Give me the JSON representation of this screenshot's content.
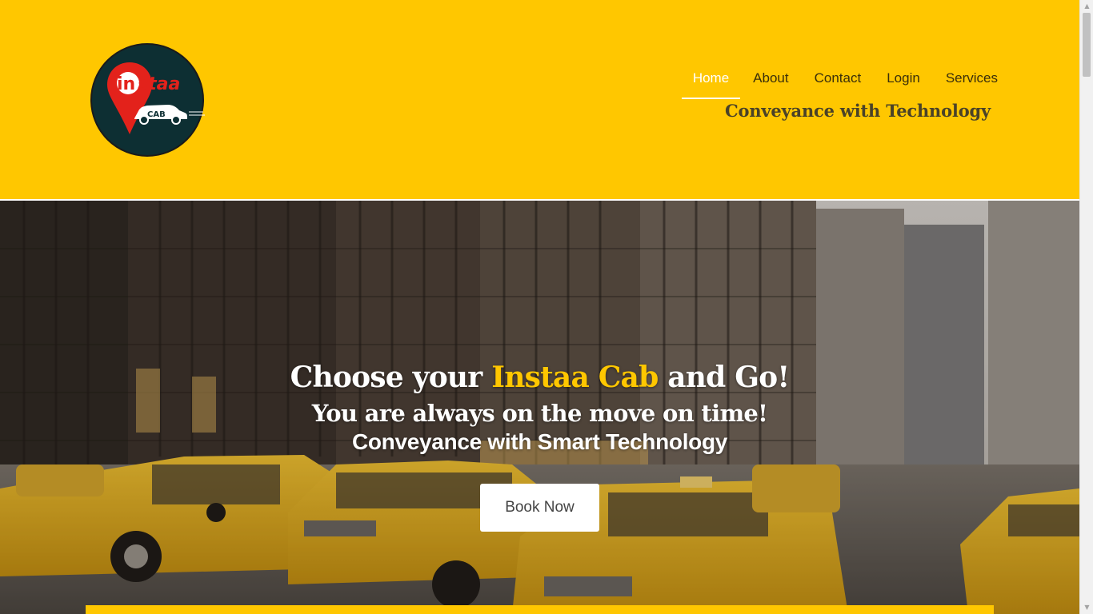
{
  "brand": {
    "logo_word": "Instaa",
    "logo_sub": "CAB",
    "tagline": "Conveyance with Technology",
    "colors": {
      "primary": "#ffc700",
      "logo_red": "#e3221b",
      "logo_dark": "#0d2f33"
    }
  },
  "nav": {
    "items": [
      {
        "label": "Home",
        "active": true
      },
      {
        "label": "About",
        "active": false
      },
      {
        "label": "Contact",
        "active": false
      },
      {
        "label": "Login",
        "active": false
      },
      {
        "label": "Services",
        "active": false
      }
    ]
  },
  "hero": {
    "headline_prefix": "Choose your",
    "headline_accent": "Instaa Cab",
    "headline_suffix": "and Go!",
    "subheadline": "You are always on the move on time!",
    "tagline": "Conveyance with Smart Technology",
    "cta_label": "Book Now",
    "background_scene": "city-street-yellow-taxis"
  },
  "icons": [
    "map-pin-icon",
    "car-icon",
    "scroll-up-arrow-icon",
    "scroll-down-arrow-icon"
  ]
}
